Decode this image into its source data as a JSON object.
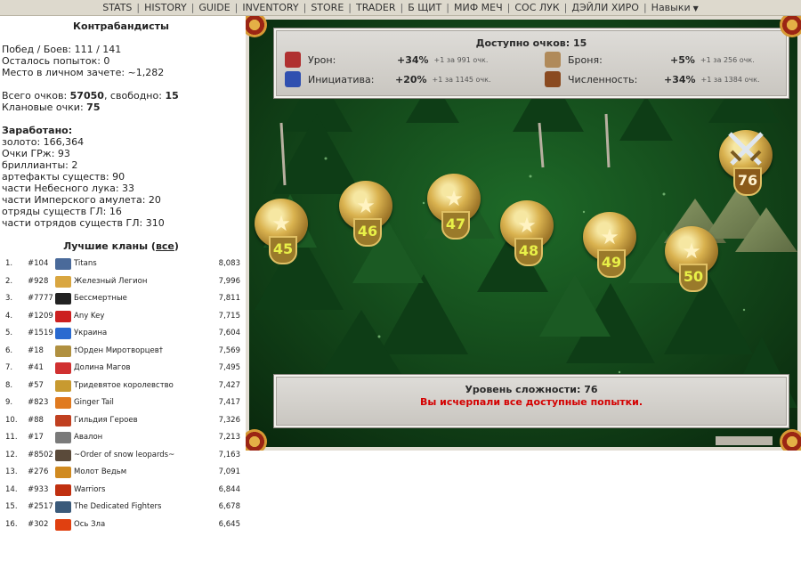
{
  "nav": {
    "items": [
      "STATS",
      "HISTORY",
      "GUIDE",
      "INVENTORY",
      "STORE",
      "TRADER",
      "Б ЩИТ",
      "МИФ МЕЧ",
      "СОС ЛУК",
      "ДЭЙЛИ ХИРО"
    ],
    "skills_label": "Навыки",
    "separator": "|"
  },
  "left": {
    "title": "Контрабандисты",
    "wins_battles": "Побед / Боев: 111 / 141",
    "attempts_left": "Осталось попыток: 0",
    "rank": "Место в личном зачете: ~1,282",
    "total_points_label": "Всего очков: ",
    "total_points": "57050",
    "free_label": ", свободно: ",
    "free_points": "15",
    "clan_points_label": "Клановые очки: ",
    "clan_points": "75",
    "earned_title": "Заработано:",
    "earned": [
      "золото: 166,364",
      "Очки ГРж: 93",
      "бриллианты: 2",
      "артефакты существ: 90",
      "части Небесного лука: 33",
      "части Имперского амулета: 20",
      "отряды существ ГЛ: 16",
      "части отрядов существ ГЛ: 310"
    ]
  },
  "clans": {
    "title": "Лучшие кланы (",
    "all_link": "все",
    "title_end": ")",
    "rows": [
      {
        "n": "1.",
        "id": "#104",
        "name": "Titans",
        "score": "8,083",
        "color": "#4a6a9a"
      },
      {
        "n": "2.",
        "id": "#928",
        "name": "Железный Легион",
        "score": "7,996",
        "color": "#d9a640"
      },
      {
        "n": "3.",
        "id": "#7777",
        "name": "Бессмертные",
        "score": "7,811",
        "color": "#222222"
      },
      {
        "n": "4.",
        "id": "#1209",
        "name": "Any Key",
        "score": "7,715",
        "color": "#cc2020"
      },
      {
        "n": "5.",
        "id": "#1519",
        "name": "Украина",
        "score": "7,604",
        "color": "#2a6ad0"
      },
      {
        "n": "6.",
        "id": "#18",
        "name": "†Орден Миротворцев†",
        "score": "7,569",
        "color": "#b09040"
      },
      {
        "n": "7.",
        "id": "#41",
        "name": "Долина Магов",
        "score": "7,495",
        "color": "#d03030"
      },
      {
        "n": "8.",
        "id": "#57",
        "name": "Тридевятое королевство",
        "score": "7,427",
        "color": "#c89a30"
      },
      {
        "n": "9.",
        "id": "#823",
        "name": "Ginger Tail",
        "score": "7,417",
        "color": "#e07a20"
      },
      {
        "n": "10.",
        "id": "#88",
        "name": "Гильдия Героев",
        "score": "7,326",
        "color": "#c04020"
      },
      {
        "n": "11.",
        "id": "#17",
        "name": "Авалон",
        "score": "7,213",
        "color": "#7a7a7a"
      },
      {
        "n": "12.",
        "id": "#8502",
        "name": "~Order of snow leopards~",
        "score": "7,163",
        "color": "#5a4a3a"
      },
      {
        "n": "13.",
        "id": "#276",
        "name": "Молот Ведьм",
        "score": "7,091",
        "color": "#d08a20"
      },
      {
        "n": "14.",
        "id": "#933",
        "name": "Warriors",
        "score": "6,844",
        "color": "#c03010"
      },
      {
        "n": "15.",
        "id": "#2517",
        "name": "The Dedicated Fighters",
        "score": "6,678",
        "color": "#3a5a7a"
      },
      {
        "n": "16.",
        "id": "#302",
        "name": "Ось Зла",
        "score": "6,645",
        "color": "#e04010"
      }
    ]
  },
  "game": {
    "points_title": "Доступно очков: 15",
    "bonuses": [
      {
        "label": "Урон:",
        "value": "+34%",
        "cost": "+1 за 991 очк.",
        "icon": "damage-icon",
        "color": "#b03030"
      },
      {
        "label": "Броня:",
        "value": "+5%",
        "cost": "+1 за 256 очк.",
        "icon": "armor-icon",
        "color": "#b08a5a"
      },
      {
        "label": "Инициатива:",
        "value": "+20%",
        "cost": "+1 за 1145 очк.",
        "icon": "initiative-icon",
        "color": "#3050b0"
      },
      {
        "label": "Численность:",
        "value": "+34%",
        "cost": "+1 за 1384 очк.",
        "icon": "numbers-icon",
        "color": "#8a4a20"
      }
    ],
    "levels": [
      "45",
      "46",
      "47",
      "48",
      "49",
      "50"
    ],
    "current_level": "76",
    "difficulty": "Уровень сложности: 76",
    "no_attempts": "Вы исчерпали все доступные попытки."
  }
}
